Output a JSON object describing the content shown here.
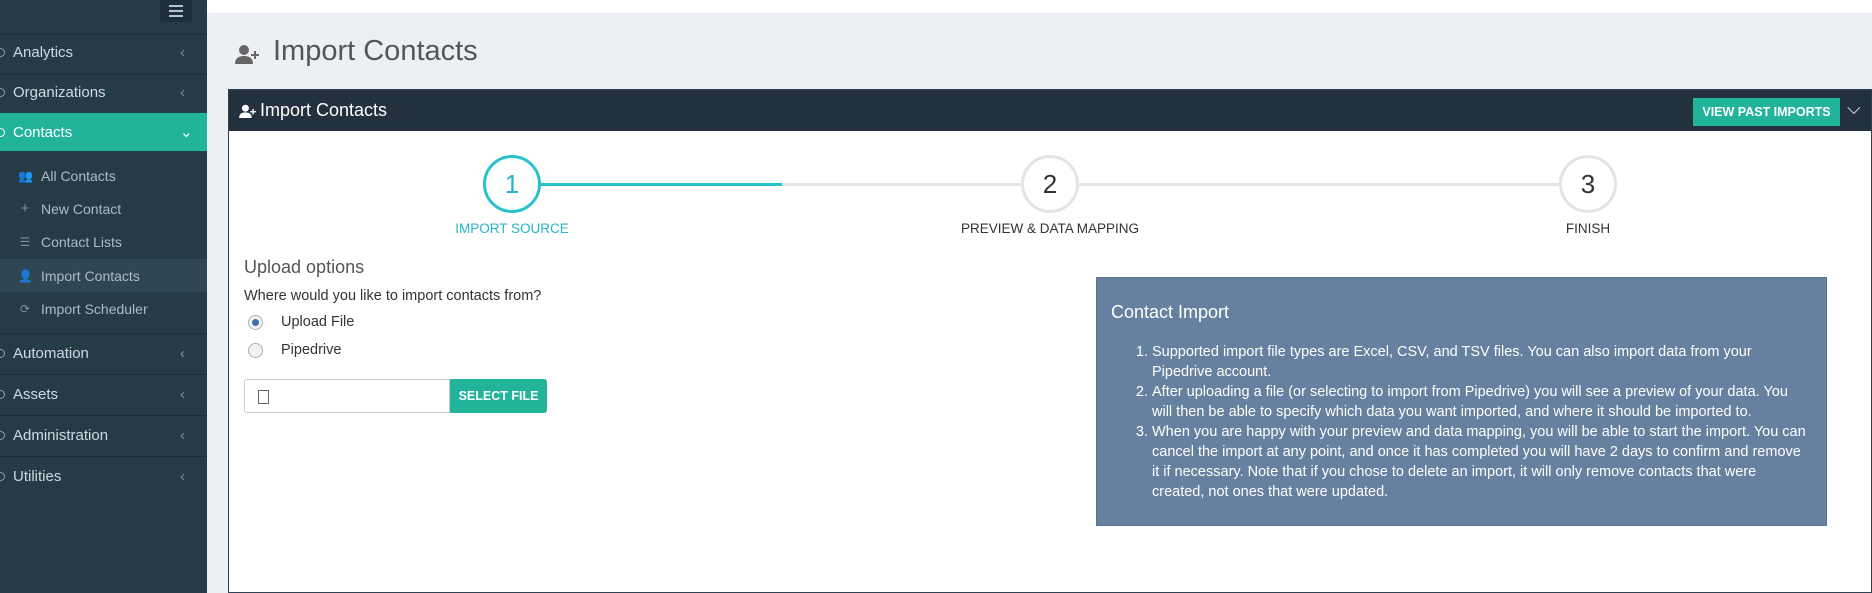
{
  "sidebar": {
    "nav": [
      {
        "label": "Analytics",
        "chevron": "‹"
      },
      {
        "label": "Organizations",
        "chevron": "‹"
      },
      {
        "label": "Contacts",
        "chevron": "⌄"
      },
      {
        "label": "Automation",
        "chevron": "‹"
      },
      {
        "label": "Assets",
        "chevron": "‹"
      },
      {
        "label": "Administration",
        "chevron": "‹"
      },
      {
        "label": "Utilities",
        "chevron": "‹"
      }
    ],
    "contacts_sub": [
      {
        "label": "All Contacts",
        "icon": "users-icon"
      },
      {
        "label": "New Contact",
        "icon": "plus-icon"
      },
      {
        "label": "Contact Lists",
        "icon": "list-icon"
      },
      {
        "label": "Import Contacts",
        "icon": "user-plus-icon"
      },
      {
        "label": "Import Scheduler",
        "icon": "refresh-icon"
      }
    ]
  },
  "page": {
    "title": "Import Contacts"
  },
  "panel": {
    "title": "Import Contacts",
    "view_past_imports": "VIEW PAST IMPORTS"
  },
  "steps": [
    {
      "number": "1",
      "label": "IMPORT SOURCE",
      "active": true
    },
    {
      "number": "2",
      "label": "PREVIEW & DATA MAPPING",
      "active": false
    },
    {
      "number": "3",
      "label": "FINISH",
      "active": false
    }
  ],
  "upload": {
    "heading": "Upload options",
    "question": "Where would you like to import contacts from?",
    "options": [
      "Upload File",
      "Pipedrive"
    ],
    "selected": "Upload File",
    "file_value": "",
    "select_file": "SELECT FILE"
  },
  "info": {
    "title": "Contact Import",
    "items": [
      "Supported import file types are Excel, CSV, and TSV files. You can also import data from your Pipedrive account.",
      "After uploading a file (or selecting to import from Pipedrive) you will see a preview of your data. You will then be able to specify which data you want imported, and where it should be imported to.",
      "When you are happy with your preview and data mapping, you will be able to start the import. You can cancel the import at any point, and once it has completed you will have 2 days to confirm and remove it if necessary. Note that if you chose to delete an import, it will only remove contacts that were created, not ones that were updated."
    ]
  },
  "colors": {
    "accent": "#21b49a",
    "sidebar": "#263b48",
    "panel_header": "#23313e",
    "step_active": "#26c2c9",
    "info_box": "#66809f"
  }
}
